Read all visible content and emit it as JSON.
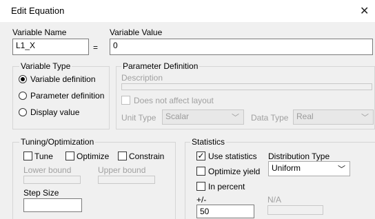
{
  "dialog": {
    "title": "Edit Equation"
  },
  "variable": {
    "name_label": "Variable Name",
    "name_value": "L1_X",
    "equals": "=",
    "value_label": "Variable Value",
    "value_value": "0"
  },
  "variable_type": {
    "label": "Variable Type",
    "options": [
      "Variable definition",
      "Parameter definition",
      "Display value"
    ],
    "selected": "Variable definition"
  },
  "parameter_definition": {
    "label": "Parameter Definition",
    "description_label": "Description",
    "no_affect_label": "Does not affect layout",
    "unit_type_label": "Unit Type",
    "unit_type_value": "Scalar",
    "data_type_label": "Data Type",
    "data_type_value": "Real"
  },
  "tuning": {
    "label": "Tuning/Optimization",
    "tune": "Tune",
    "optimize": "Optimize",
    "constrain": "Constrain",
    "lower_bound": "Lower bound",
    "upper_bound": "Upper bound",
    "step_size": "Step Size"
  },
  "statistics": {
    "label": "Statistics",
    "use_statistics": "Use statistics",
    "use_statistics_checked": true,
    "distribution_type_label": "Distribution Type",
    "distribution_value": "Uniform",
    "optimize_yield": "Optimize yield",
    "in_percent": "In percent",
    "plus_minus_label": "+/-",
    "plus_minus_value": "50",
    "na_label": "N/A"
  },
  "icons": {
    "close": "close-icon",
    "dropdown": "chevron-down-icon",
    "check": "check-icon"
  }
}
